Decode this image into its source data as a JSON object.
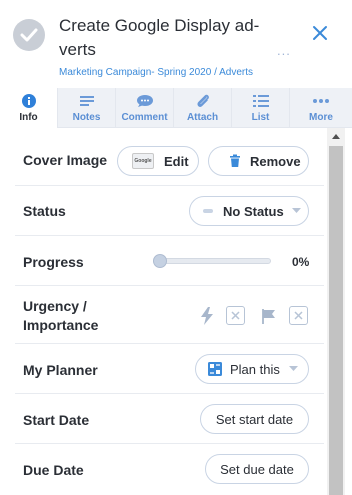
{
  "header": {
    "title": "Create Google Display ad-verts",
    "breadcrumb": "Marketing Campaign- Spring 2020 / Adverts",
    "ellipsis": "...",
    "accent": "#3b8ad9"
  },
  "tabs": [
    {
      "label": "Info",
      "icon": "info-icon",
      "active": true
    },
    {
      "label": "Notes",
      "icon": "notes-icon"
    },
    {
      "label": "Comment",
      "icon": "comment-icon"
    },
    {
      "label": "Attach",
      "icon": "paperclip-icon"
    },
    {
      "label": "List",
      "icon": "list-icon"
    },
    {
      "label": "More",
      "icon": "more-dots-icon"
    }
  ],
  "fields": {
    "cover_image": {
      "label": "Cover Image",
      "edit_label": "Edit",
      "remove_label": "Remove",
      "thumb_text": "Google"
    },
    "status": {
      "label": "Status",
      "value": "No Status"
    },
    "progress": {
      "label": "Progress",
      "value": "0%",
      "fraction": 0
    },
    "urgency": {
      "label_line1": "Urgency /",
      "label_line2": "Importance"
    },
    "planner": {
      "label": "My Planner",
      "value": "Plan this"
    },
    "start_date": {
      "label": "Start Date",
      "button": "Set start date"
    },
    "due_date": {
      "label": "Due Date",
      "button": "Set due date"
    }
  }
}
